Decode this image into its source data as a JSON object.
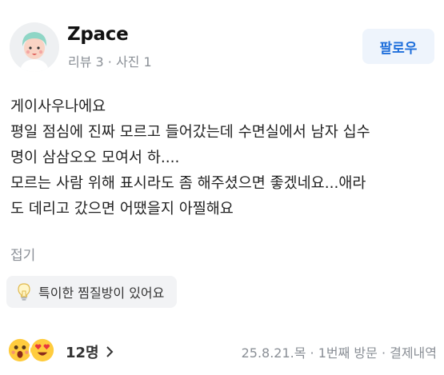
{
  "user": {
    "name": "Zpace",
    "meta": "리뷰 3 · 사진 1",
    "follow_label": "팔로우"
  },
  "review": {
    "lines": [
      "게이사우나에요",
      "평일 점심에 진짜 모르고 들어갔는데 수면실에서 남자 십수",
      "명이 삼삼오오 모여서 하....",
      "모르는 사람 위해 표시라도 좀 해주셨으면 좋겠네요...애라",
      "도 데리고 갔으면 어땠을지 아찔해요"
    ],
    "collapse_label": "접기"
  },
  "tag": {
    "icon": "lightbulb-icon",
    "label": "특이한 찜질방이 있어요"
  },
  "footer": {
    "reaction_icons": [
      "surprised-face-icon",
      "heart-eyes-face-icon"
    ],
    "reaction_count": "12명",
    "visit_meta": "25.8.21.목 · 1번째 방문 · 결제내역"
  },
  "colors": {
    "accent": "#1f6fdb",
    "follow_bg": "#eef4fc",
    "muted_text": "#8a8f96",
    "tag_bg": "#f2f3f5"
  }
}
